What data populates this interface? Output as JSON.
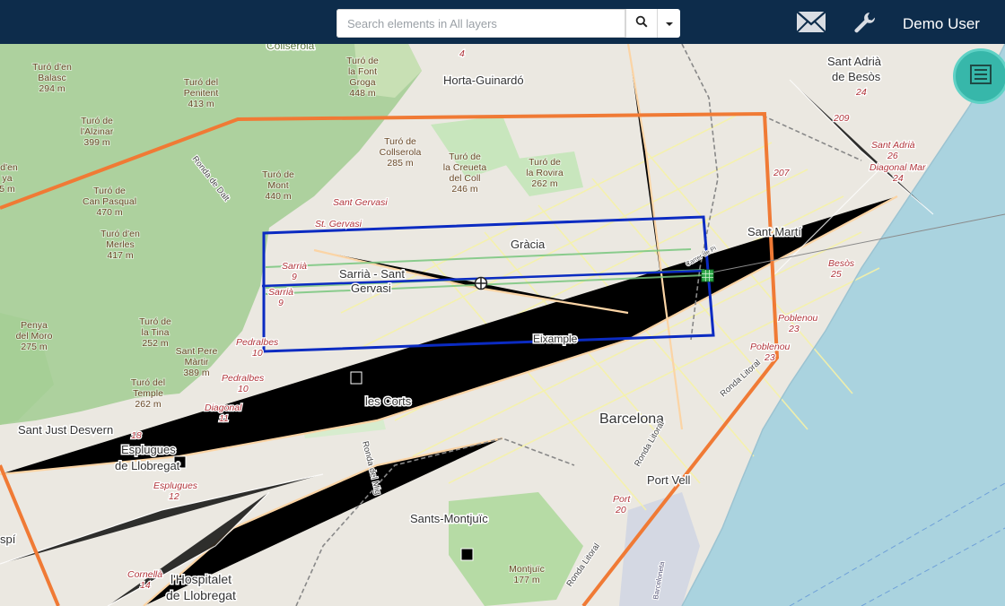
{
  "header": {
    "search_placeholder": "Search elements in All layers",
    "user_name": "Demo User",
    "icons": [
      "search-icon",
      "caret-down-icon",
      "mail-icon",
      "wrench-icon",
      "list-icon"
    ],
    "bg_color": "#0d2c4b"
  },
  "map": {
    "colors": {
      "zone": "#f07a35",
      "rect": "#0b2bc2",
      "sea": "#aad3df",
      "forest": "#a3d29c",
      "marker": "#000000",
      "grid_marker": "#2fa84a"
    },
    "districts": {
      "horta": "Horta-Guinardó",
      "gracia": "Gràcia",
      "sarria1": "Sarrià - Sant",
      "sarria2": "Gervasi",
      "eixample": "Eixample",
      "sant_marti": "Sant Martí",
      "les_corts": "les Corts",
      "barcelona": "Barcelona",
      "sants": "Sants-Montjuïc",
      "sant_just": "Sant Just Desvern",
      "esplugues1": "Esplugues",
      "esplugues2": "de Llobregat",
      "hospitalet1": "l'Hospitalet",
      "hospitalet2": "de Llobregat",
      "port_vell": "Port Vell",
      "sant_adria1": "Sant Adrià",
      "sant_adria2": "de Besòs",
      "collserola": "Collserola",
      "spi": "spí"
    },
    "peaks": {
      "balasc": [
        "Turó d'en",
        "Balasc",
        "294 m"
      ],
      "penitent": [
        "Turó del",
        "Penitent",
        "413 m"
      ],
      "font_groga": [
        "Turó de",
        "la Font",
        "Groga",
        "448 m"
      ],
      "alzinar": [
        "Turó de",
        "l'Alzinar",
        "399 m"
      ],
      "den": [
        "d'en",
        "ya",
        "5 m"
      ],
      "can_pasqual": [
        "Turó de",
        "Can Pasqual",
        "470 m"
      ],
      "mont": [
        "Turó de",
        "Mont",
        "440 m"
      ],
      "collserola_p": [
        "Turó de",
        "Collserola",
        "285 m"
      ],
      "creueta": [
        "Turó de",
        "la Creueta",
        "del Coll",
        "246 m"
      ],
      "rovira": [
        "Turó de",
        "la Rovira",
        "262 m"
      ],
      "merles": [
        "Turó d'en",
        "Merles",
        "417 m"
      ],
      "penya": [
        "Penya",
        "del Moro",
        "275 m"
      ],
      "tina": [
        "Turó de",
        "la Tina",
        "252 m"
      ],
      "sant_pere": [
        "Sant Pere",
        "Màrtir",
        "389 m"
      ],
      "temple": [
        "Turó del",
        "Temple",
        "262 m"
      ],
      "montjuic": [
        "Montjuïc",
        "177 m"
      ]
    },
    "stations": {
      "sant_gervasi": "Sant Gervasi",
      "st_gervasi": "St. Gervasi",
      "sarria_a": "Sarrià",
      "sarria_a_n": "9",
      "sarria_b": "Sarrià",
      "sarria_b_n": "9",
      "pedralbes_a": "Pedralbes",
      "pedralbes_a_n": "10",
      "pedralbes_b": "Pedralbes",
      "pedralbes_b_n": "10",
      "diagonal": "Diagonal",
      "diagonal_n": "11",
      "esplugues_st": "Esplugues",
      "esplugues_n": "12",
      "cornella": "Cornellà",
      "cornella_n": "14",
      "port": "Port",
      "port_n": "20",
      "poblenou_a": "Poblenou",
      "poblenou_a_n": "23",
      "poblenou_b": "Poblenou",
      "poblenou_b_n": "23",
      "besos": "Besòs",
      "besos_n": "25",
      "sant_adria_st": "Sant Adrià",
      "sant_adria_n": "26",
      "diagonal_mar": "Diagonal Mar",
      "diagonal_mar_n": "24",
      "n207": "207",
      "n209": "209",
      "n24": "24",
      "n4": "4",
      "n18": "18"
    },
    "roads": {
      "ronda_mig": "Ronda del Mig",
      "ronda_litoral": "Ronda Litoral",
      "ronda_litoral2": "Ronda Litoral",
      "ronda_litoral3": "Ronda Litoral",
      "barceloneta": "Barceloneta",
      "ronda_dalt": "Ronda de Dalt",
      "calle": "Carrer de Pi"
    }
  }
}
